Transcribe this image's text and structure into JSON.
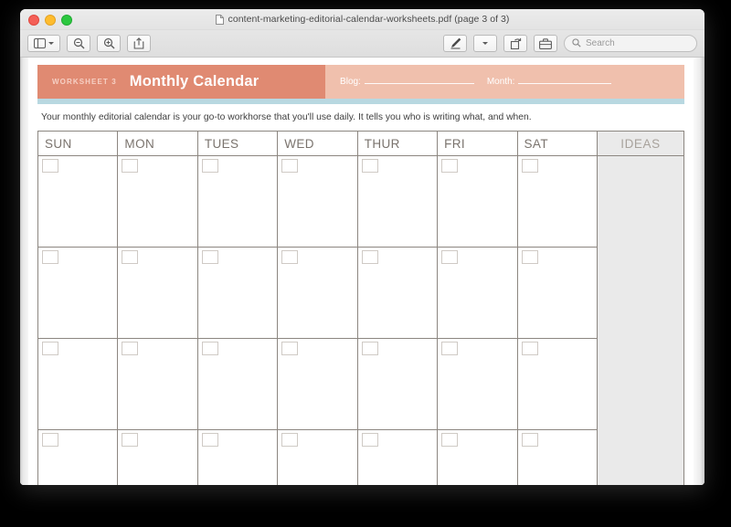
{
  "window": {
    "title": "content-marketing-editorial-calendar-worksheets.pdf (page 3 of 3)",
    "traffic_lights": [
      "close-button",
      "minimize-button",
      "zoom-button"
    ]
  },
  "toolbar": {
    "sidebar_button": "sidebar-toggle",
    "zoom_out_button": "zoom-out",
    "zoom_in_button": "zoom-in",
    "share_button": "share",
    "markup_button": "markup-pen",
    "markup_dropdown": "markup-options",
    "rotate_button": "rotate",
    "toolbox_button": "toolbox",
    "search": {
      "placeholder": "Search",
      "value": ""
    }
  },
  "worksheet": {
    "number_label": "WORKSHEET 3",
    "title": "Monthly Calendar",
    "fields": [
      {
        "label": "Blog:",
        "value": ""
      },
      {
        "label": "Month:",
        "value": ""
      }
    ],
    "intro": "Your monthly editorial calendar is your go-to workhorse that you'll use daily. It tells you who is writing what, and when.",
    "colors": {
      "header_primary": "#E08A72",
      "header_secondary": "#F0C0AD",
      "accent_strip": "#B8D8E1",
      "grid_line": "#8C8680",
      "ideas_background": "#EAEAEA"
    }
  },
  "calendar": {
    "day_headers": [
      "SUN",
      "MON",
      "TUES",
      "WED",
      "THUR",
      "FRI",
      "SAT"
    ],
    "ideas_header": "IDEAS",
    "week_rows": 4,
    "cells": [
      [
        "",
        "",
        "",
        "",
        "",
        "",
        ""
      ],
      [
        "",
        "",
        "",
        "",
        "",
        "",
        ""
      ],
      [
        "",
        "",
        "",
        "",
        "",
        "",
        ""
      ],
      [
        "",
        "",
        "",
        "",
        "",
        "",
        ""
      ]
    ],
    "ideas_notes": ""
  }
}
